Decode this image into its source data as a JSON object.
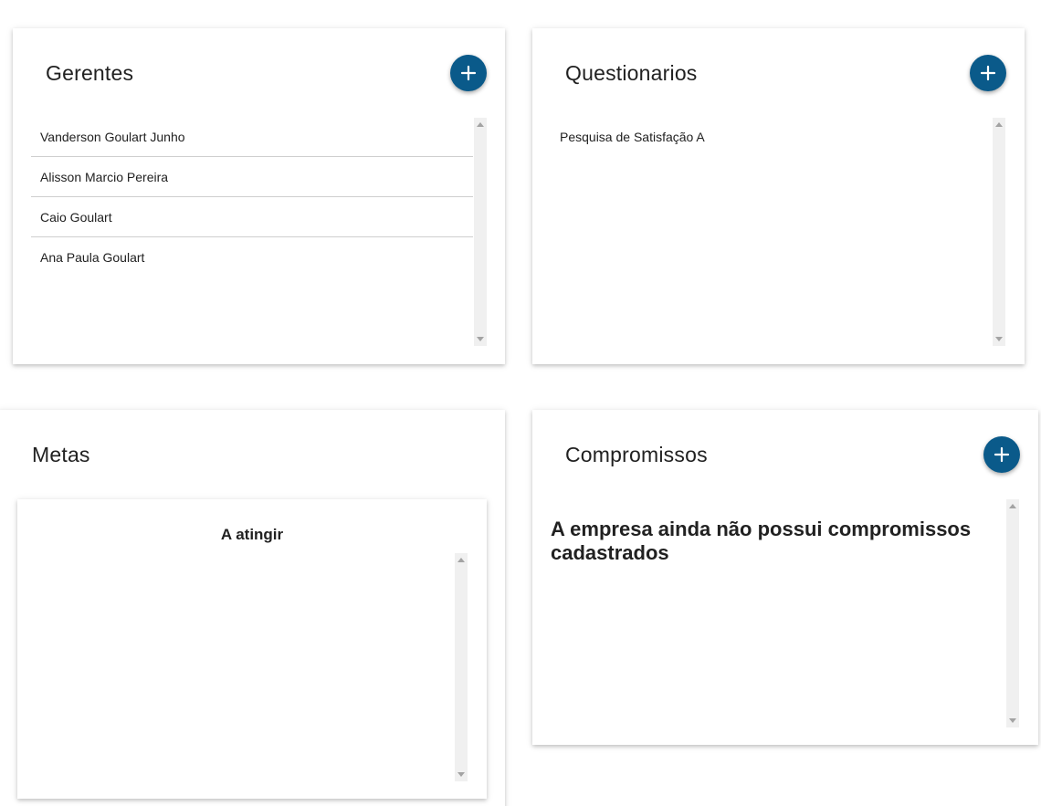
{
  "gerentes": {
    "title": "Gerentes",
    "add_icon": "plus-icon",
    "items": [
      "Vanderson Goulart Junho",
      "Alisson Marcio Pereira",
      "Caio Goulart",
      "Ana Paula Goulart"
    ]
  },
  "questionarios": {
    "title": "Questionarios",
    "add_icon": "plus-icon",
    "items": [
      "Pesquisa de Satisfação A"
    ]
  },
  "metas": {
    "title": "Metas",
    "subcard_title": "A atingir"
  },
  "compromissos": {
    "title": "Compromissos",
    "add_icon": "plus-icon",
    "empty_message": "A empresa ainda não possui compromissos cadastrados"
  },
  "colors": {
    "fab": "#0a5a8a",
    "scrollbar_track": "#f0f0f0",
    "divider": "#cfcfcf"
  }
}
